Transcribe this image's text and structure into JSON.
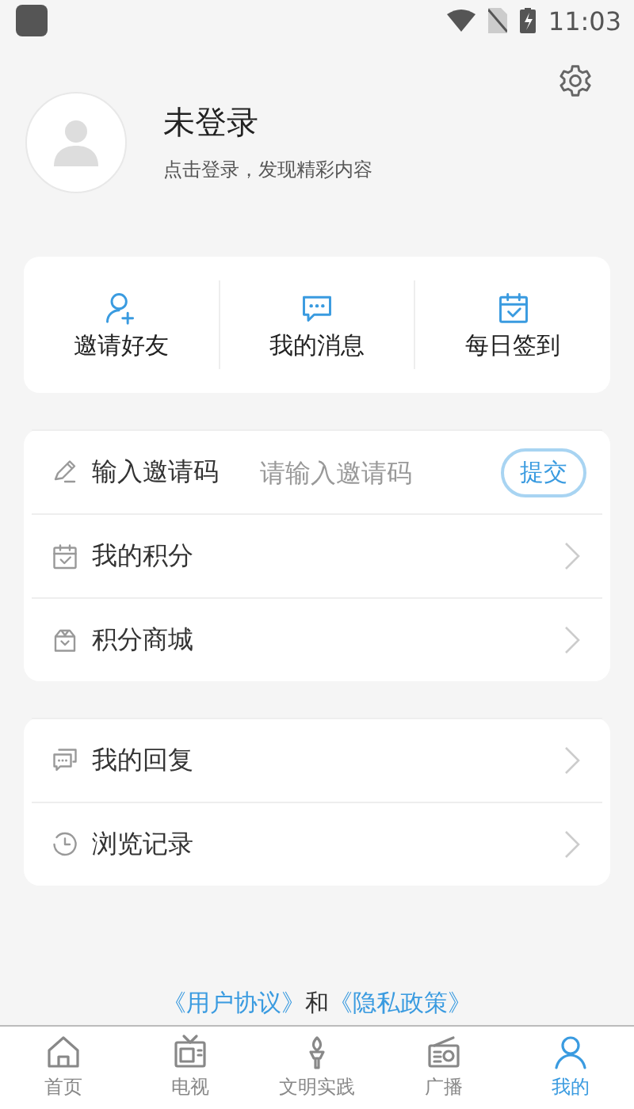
{
  "status_bar": {
    "time": "11:03"
  },
  "profile": {
    "name": "未登录",
    "subtitle": "点击登录，发现精彩内容"
  },
  "quick_actions": [
    {
      "label": "邀请好友",
      "kind": "invite"
    },
    {
      "label": "我的消息",
      "kind": "message"
    },
    {
      "label": "每日签到",
      "kind": "checkin"
    }
  ],
  "menu_cards": [
    {
      "items": [
        {
          "kind": "code",
          "label": "输入邀请码",
          "placeholder": "请输入邀请码",
          "button": "提交"
        },
        {
          "kind": "points",
          "label": "我的积分"
        },
        {
          "kind": "shop",
          "label": "积分商城"
        }
      ]
    },
    {
      "items": [
        {
          "kind": "reply",
          "label": "我的回复"
        },
        {
          "kind": "history",
          "label": "浏览记录"
        }
      ]
    }
  ],
  "agreement": [
    {
      "text": "《用户协议》",
      "link": true
    },
    {
      "text": "和",
      "link": false
    },
    {
      "text": "《隐私政策》",
      "link": true
    }
  ],
  "tabs": [
    {
      "label": "首页",
      "kind": "home",
      "selected": false
    },
    {
      "label": "电视",
      "kind": "tv",
      "selected": false
    },
    {
      "label": "文明实践",
      "kind": "torch",
      "selected": false
    },
    {
      "label": "广播",
      "kind": "radio",
      "selected": false
    },
    {
      "label": "我的",
      "kind": "person",
      "selected": true
    }
  ]
}
